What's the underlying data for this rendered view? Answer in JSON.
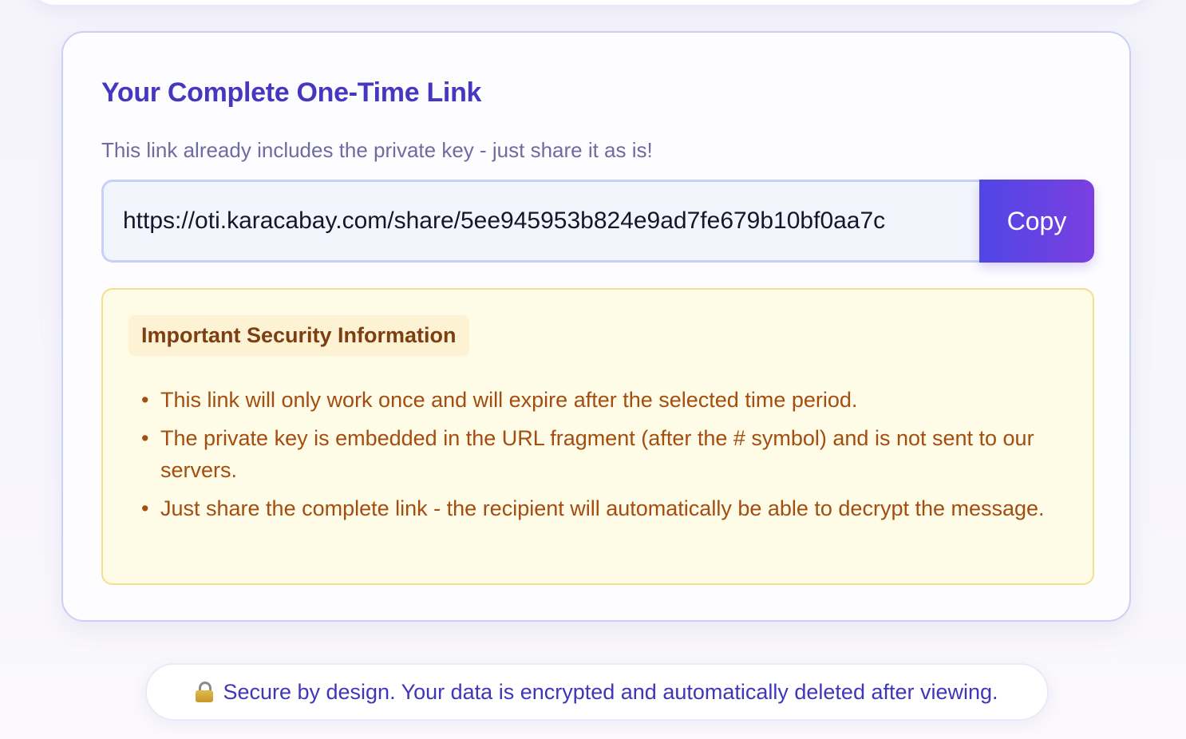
{
  "card": {
    "title": "Your Complete One-Time Link",
    "subtitle": "This link already includes the private key - just share it as is!",
    "link_value": "https://oti.karacabay.com/share/5ee945953b824e9ad7fe679b10bf0aa7c",
    "copy_label": "Copy"
  },
  "security": {
    "heading": "Important Security Information",
    "items": [
      "This link will only work once and will expire after the selected time period.",
      "The private key is embedded in the URL fragment (after the # symbol) and is not sent to our servers.",
      "Just share the complete link - the recipient will automatically be able to decrypt the message."
    ]
  },
  "footer": {
    "icon": "lock-icon",
    "text": "Secure by design. Your data is encrypted and automatically deleted after viewing."
  },
  "colors": {
    "title": "#4537c0",
    "accent_start": "#4f46e5",
    "accent_end": "#7b3fe0",
    "warning_bg": "#fefbe6",
    "warning_border": "#f2e08a",
    "warning_text": "#a34d10"
  }
}
